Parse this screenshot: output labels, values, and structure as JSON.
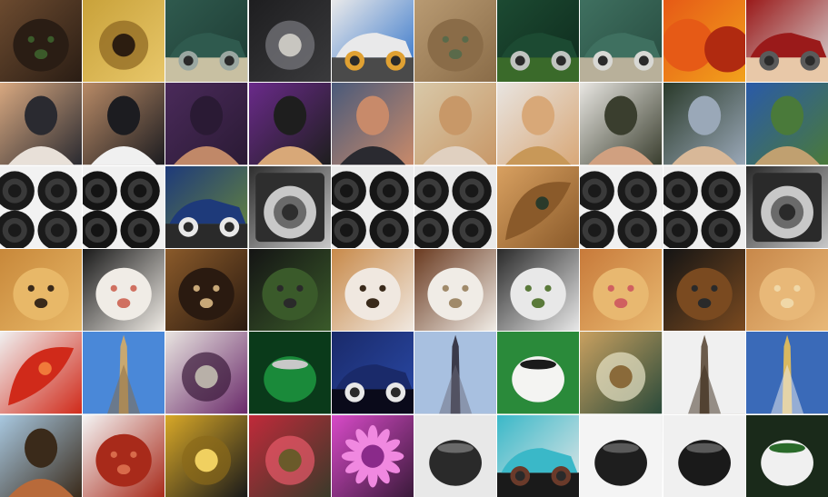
{
  "grid": {
    "rows": 6,
    "cols": 10,
    "tiles": [
      {
        "subject": "dog",
        "colors": [
          "#6b4a2f",
          "#2a1d14",
          "#c98a6a",
          "#3b5a2a"
        ]
      },
      {
        "subject": "piggy-bank",
        "colors": [
          "#c9a23a",
          "#e8c76a",
          "#8a6420",
          "#2c1d10"
        ]
      },
      {
        "subject": "car",
        "colors": [
          "#2f5a4e",
          "#1d3a32",
          "#9aa7a1",
          "#c8c0a2"
        ]
      },
      {
        "subject": "fur-hat",
        "colors": [
          "#1e1e20",
          "#3a3a3c",
          "#7a7b80",
          "#c8c6c0"
        ]
      },
      {
        "subject": "car",
        "colors": [
          "#e9e9ea",
          "#2b6fc8",
          "#e0a132",
          "#4a4a4a"
        ]
      },
      {
        "subject": "dog",
        "colors": [
          "#b89a72",
          "#8a6c48",
          "#d8c4a2",
          "#5a6a4a"
        ]
      },
      {
        "subject": "car",
        "colors": [
          "#1c4a32",
          "#0e2a1c",
          "#c0c4c0",
          "#3a6a2a"
        ]
      },
      {
        "subject": "car",
        "colors": [
          "#3f7060",
          "#264a3e",
          "#d8d8d4",
          "#b8b09a"
        ]
      },
      {
        "subject": "fruit",
        "colors": [
          "#e65a16",
          "#f2a21c",
          "#ffc84a",
          "#b02a10"
        ]
      },
      {
        "subject": "car",
        "colors": [
          "#9a1a1a",
          "#d8d8d8",
          "#5a5a5a",
          "#e8c8a8"
        ]
      },
      {
        "subject": "person",
        "colors": [
          "#d8a880",
          "#2a2a30",
          "#e8e0d8",
          "#a07040"
        ]
      },
      {
        "subject": "person",
        "colors": [
          "#b88a66",
          "#1c1c20",
          "#f0f0f0",
          "#40302a"
        ]
      },
      {
        "subject": "person",
        "colors": [
          "#4a2a5a",
          "#2a1a34",
          "#c08868",
          "#6a4a6a"
        ]
      },
      {
        "subject": "person",
        "colors": [
          "#6a2a8a",
          "#1e1e1e",
          "#d8a878",
          "#5a3a7a"
        ]
      },
      {
        "subject": "person",
        "colors": [
          "#4a5a7a",
          "#c88a6a",
          "#2a2a30",
          "#b82a2a"
        ]
      },
      {
        "subject": "person",
        "colors": [
          "#d8c8a8",
          "#c89868",
          "#e0d0c0",
          "#b03020"
        ]
      },
      {
        "subject": "person",
        "colors": [
          "#e8e4e0",
          "#d8a878",
          "#c89858",
          "#4a6a3a"
        ]
      },
      {
        "subject": "person",
        "colors": [
          "#e8e6e2",
          "#3a3e2e",
          "#d0a080",
          "#2a2a28"
        ]
      },
      {
        "subject": "person",
        "colors": [
          "#2a3a2a",
          "#9aa8b8",
          "#d8b898",
          "#1a1a1a"
        ]
      },
      {
        "subject": "person",
        "colors": [
          "#2a5aa8",
          "#4a7a3a",
          "#c0a070",
          "#1a1a1a"
        ]
      },
      {
        "subject": "lens",
        "colors": [
          "#f2f2f2",
          "#1a1a1a",
          "#8a8a8a",
          "#3a3a3a"
        ]
      },
      {
        "subject": "lens",
        "colors": [
          "#f0f0f0",
          "#141414",
          "#7a7a7a",
          "#3a3a3a"
        ]
      },
      {
        "subject": "tractor",
        "colors": [
          "#1e3a7a",
          "#6a8a3a",
          "#e8e8e8",
          "#2a2a2a"
        ]
      },
      {
        "subject": "camera",
        "colors": [
          "#2e2e2e",
          "#c8c8c8",
          "#6a6a6a",
          "#e8e8e8"
        ]
      },
      {
        "subject": "lens",
        "colors": [
          "#ececec",
          "#161616",
          "#8a8a8a",
          "#3a3a3a"
        ]
      },
      {
        "subject": "lens",
        "colors": [
          "#eaeaea",
          "#181818",
          "#888888",
          "#3c3c3c"
        ]
      },
      {
        "subject": "butterfly",
        "colors": [
          "#d8a060",
          "#8a5a2a",
          "#2a3a2a",
          "#f0c888"
        ]
      },
      {
        "subject": "lens",
        "colors": [
          "#f0f0f0",
          "#1a1a1a",
          "#8a8a8a",
          "#3a3a3a"
        ]
      },
      {
        "subject": "lens",
        "colors": [
          "#eeeeee",
          "#181818",
          "#8a8a8a",
          "#3a3a3a"
        ]
      },
      {
        "subject": "camera",
        "colors": [
          "#2a2a2a",
          "#c8c8c8",
          "#6a6a6a",
          "#e6e6e6"
        ]
      },
      {
        "subject": "dog",
        "colors": [
          "#c8883a",
          "#e8b868",
          "#5a7a2a",
          "#3a2a1a"
        ]
      },
      {
        "subject": "dog",
        "colors": [
          "#1a1a1a",
          "#f0ece6",
          "#8a7a6a",
          "#d07060"
        ]
      },
      {
        "subject": "dog",
        "colors": [
          "#8a5a2a",
          "#2a1a10",
          "#6a8a3a",
          "#c8a878"
        ]
      },
      {
        "subject": "bear",
        "colors": [
          "#141414",
          "#3a5a2a",
          "#7a9a4a",
          "#2a2a2a"
        ]
      },
      {
        "subject": "dog",
        "colors": [
          "#c88a4a",
          "#f0e8e0",
          "#8a6a4a",
          "#3a2a1a"
        ]
      },
      {
        "subject": "dog",
        "colors": [
          "#6a3a20",
          "#f0ece6",
          "#2a1a10",
          "#a08a6a"
        ]
      },
      {
        "subject": "dog",
        "colors": [
          "#2a2a2a",
          "#e8e8e8",
          "#8a8a8a",
          "#5a7a3a"
        ]
      },
      {
        "subject": "dog",
        "colors": [
          "#c87a3a",
          "#e8b870",
          "#6a3a1a",
          "#d06060"
        ]
      },
      {
        "subject": "dog",
        "colors": [
          "#141414",
          "#7a4a20",
          "#c08a50",
          "#2a2a2a"
        ]
      },
      {
        "subject": "dog",
        "colors": [
          "#c8884a",
          "#e8b878",
          "#8a5a2a",
          "#f0d8a8"
        ]
      },
      {
        "subject": "red-leaf",
        "colors": [
          "#f0f0f0",
          "#d02a1a",
          "#f07a3a",
          "#ffffff"
        ]
      },
      {
        "subject": "obelisk",
        "colors": [
          "#4a88d8",
          "#c8a870",
          "#8a6a40",
          "#a8c8f0"
        ]
      },
      {
        "subject": "bag",
        "colors": [
          "#e8e4e0",
          "#6a2a6a",
          "#3a1a3a",
          "#b8b0a8"
        ]
      },
      {
        "subject": "green-dial",
        "colors": [
          "#1a8a3a",
          "#0a3a1a",
          "#c8c8c8",
          "#6a6a6a"
        ]
      },
      {
        "subject": "car",
        "colors": [
          "#1a2a6a",
          "#2a4aa8",
          "#e8e8e8",
          "#0a0a1a"
        ]
      },
      {
        "subject": "obelisk",
        "colors": [
          "#a8c0e0",
          "#3a3a4a",
          "#6a6a7a",
          "#d8e4f0"
        ]
      },
      {
        "subject": "tape-roll",
        "colors": [
          "#f4f4f2",
          "#2a8a3a",
          "#1a1a1a",
          "#c8c8c8"
        ]
      },
      {
        "subject": "basket",
        "colors": [
          "#c8a060",
          "#2a4a3a",
          "#e8e4c8",
          "#8a6a3a"
        ]
      },
      {
        "subject": "tower",
        "colors": [
          "#f0f0f0",
          "#6a5a4a",
          "#3a2a1a",
          "#b8b0a0"
        ]
      },
      {
        "subject": "stupa",
        "colors": [
          "#3a6ab8",
          "#d8b860",
          "#f0f0f0",
          "#2a2a2a"
        ]
      },
      {
        "subject": "person",
        "colors": [
          "#a8c8e0",
          "#3a2a1a",
          "#b86a3a",
          "#2a5a2a"
        ]
      },
      {
        "subject": "panda",
        "colors": [
          "#f4f4f4",
          "#a82a1a",
          "#141414",
          "#d86a4a"
        ]
      },
      {
        "subject": "fabric",
        "colors": [
          "#d8a828",
          "#1a1a1a",
          "#8a6a1a",
          "#f0d060"
        ]
      },
      {
        "subject": "fabric",
        "colors": [
          "#c02a3a",
          "#3a3a2a",
          "#e85a6a",
          "#6a5a2a"
        ]
      },
      {
        "subject": "flower",
        "colors": [
          "#d84ac8",
          "#3a1a3a",
          "#f088e0",
          "#8a2a8a"
        ]
      },
      {
        "subject": "pot",
        "colors": [
          "#2a2a2a",
          "#e8e8e8",
          "#6a6a6a",
          "#0a0a0a"
        ]
      },
      {
        "subject": "scooter",
        "colors": [
          "#3ab8c8",
          "#e8e8e8",
          "#6a3a2a",
          "#1a1a1a"
        ]
      },
      {
        "subject": "teapot",
        "colors": [
          "#1e1e1e",
          "#f4f4f4",
          "#5a5a5a",
          "#0a0a0a"
        ]
      },
      {
        "subject": "pot",
        "colors": [
          "#1a1a1a",
          "#f0f0f0",
          "#5a5a5a",
          "#3a3a3a"
        ]
      },
      {
        "subject": "teapot",
        "colors": [
          "#f0f0f0",
          "#1a2a1a",
          "#2a6a2a",
          "#8ab08a"
        ]
      }
    ]
  }
}
